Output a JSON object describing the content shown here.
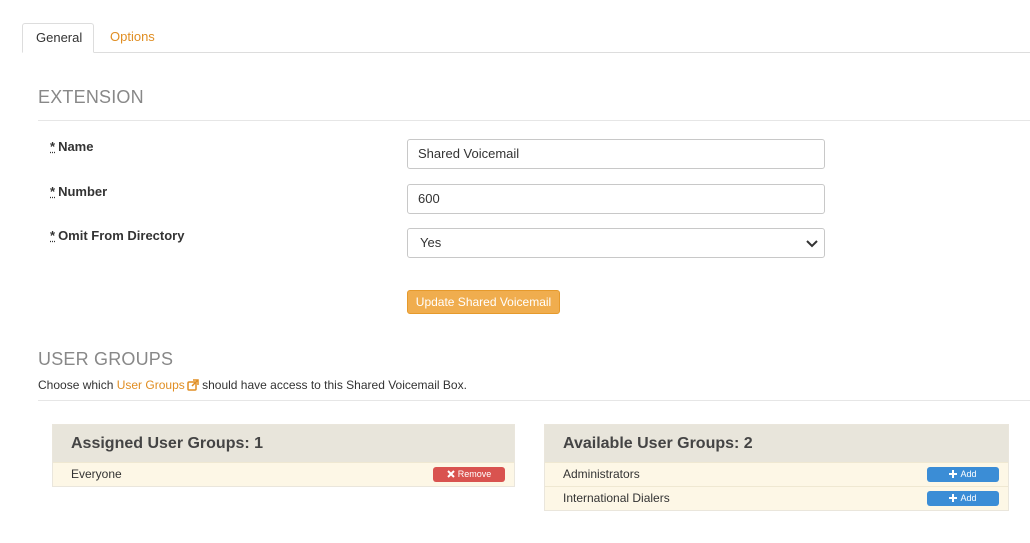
{
  "tabs": [
    {
      "label": "General",
      "active": true
    },
    {
      "label": "Options",
      "active": false
    }
  ],
  "extension": {
    "title": "EXTENSION",
    "required_marker": "*",
    "fields": {
      "name": {
        "label": "Name",
        "value": "Shared Voicemail"
      },
      "number": {
        "label": "Number",
        "value": "600"
      },
      "omit": {
        "label": "Omit From Directory",
        "selected": "Yes"
      }
    },
    "update_button": "Update Shared Voicemail"
  },
  "user_groups": {
    "title": "USER GROUPS",
    "desc_prefix": "Choose which",
    "desc_link": "User Groups",
    "desc_suffix": "should have access to this Shared Voicemail Box.",
    "assigned": {
      "header": "Assigned User Groups: 1",
      "items": [
        {
          "name": "Everyone",
          "action": "Remove"
        }
      ]
    },
    "available": {
      "header": "Available User Groups: 2",
      "items": [
        {
          "name": "Administrators",
          "action": "Add"
        },
        {
          "name": "International Dialers",
          "action": "Add"
        }
      ]
    }
  },
  "colors": {
    "accent": "#e08e23",
    "update_button": "#f0ad4e",
    "remove_button": "#d9534f",
    "add_button": "#3b8dd6",
    "panel_header": "#e8e5db",
    "panel_row": "#fdf7e6"
  },
  "icons": [
    "external-link-icon",
    "chevron-down-icon",
    "times-icon",
    "plus-icon"
  ]
}
